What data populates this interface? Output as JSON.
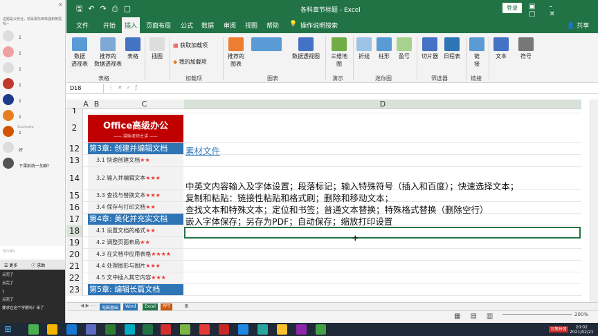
{
  "chat": {
    "top_text": "这题是公务仕，快哥那东西单选和英语吗~",
    "close": "×",
    "messages": [
      {
        "name": "",
        "text": "1",
        "color": "#ddd"
      },
      {
        "name": "",
        "text": "1",
        "color": "#f0a0a0"
      },
      {
        "name": "",
        "text": "1",
        "color": "#ddd"
      },
      {
        "name": "",
        "text": "1",
        "color": "#c0392b"
      },
      {
        "name": "",
        "text": "1",
        "color": "#1e3a8a"
      },
      {
        "name": "",
        "text": "1",
        "color": "#e67e22"
      },
      {
        "name": "Soulmate",
        "text": "1",
        "color": "#d35400"
      },
      {
        "name": "",
        "text": "好",
        "color": "#ddd"
      },
      {
        "name": "",
        "text": "下课前统一加群！",
        "color": "#555"
      }
    ],
    "input_count": "0/140",
    "bar_more": "更多",
    "bar_help": "求助",
    "bottom": [
      {
        "name": "",
        "text": "点完了"
      },
      {
        "name": "",
        "text": "点完了"
      },
      {
        "name": "",
        "text": "1"
      },
      {
        "name": "",
        "text": "点完了"
      },
      {
        "name": "",
        "text": "要求在这个学期吗？来了"
      }
    ]
  },
  "excel": {
    "title": "各科章节标题 - Excel",
    "login": "登录",
    "tabs": [
      "文件",
      "开始",
      "插入",
      "页面布局",
      "公式",
      "数据",
      "审阅",
      "视图",
      "帮助",
      "操作说明搜索"
    ],
    "selected_tab": "插入",
    "share": "共享",
    "ribbon": {
      "btn1": "数据\n透视表",
      "btn2": "推荐的\n数据透视表",
      "btn3": "表格",
      "btn4": "插图",
      "addin1": "获取加载项",
      "addin2": "我的加载项",
      "btn5": "推荐的\n图表",
      "btn6": "数据透视图",
      "btn7": "三维地\n图",
      "btn8": "折线",
      "btn9": "柱形",
      "btn10": "盈亏",
      "btn11": "切片器",
      "btn12": "日程表",
      "btn13": "链\n接",
      "btn14": "文本",
      "btn15": "符号",
      "groups": [
        "表格",
        "加载项",
        "图表",
        "演示",
        "迷你图",
        "筛选器",
        "链接"
      ]
    },
    "name_box": "D18",
    "columns": [
      "A",
      "B",
      "C",
      "D"
    ],
    "logo_title": "Office高级办公",
    "logo_sub": "—— 梁咏老师主讲 ——",
    "rows": [
      {
        "num": "1",
        "c": "",
        "d": ""
      },
      {
        "num": "2",
        "c": "",
        "d": ""
      },
      {
        "num": "12",
        "c": "第3章: 创建并编辑文档",
        "type": "ch",
        "d": "素材文件"
      },
      {
        "num": "13",
        "c": "3.1 快速创建文档",
        "stars": "★★",
        "type": "sec",
        "d": ""
      },
      {
        "num": "14",
        "c": "3.2 输入并编辑文本",
        "stars": "★★★",
        "type": "sec",
        "d": "中英文内容输入及字体设置；段落标记；输入特殊符号（插入和百度）；快速选择文本；"
      },
      {
        "num": "15",
        "c": "3.3 查找与替换文本",
        "stars": "★★★",
        "type": "sec",
        "d": "复制和粘贴：链接性粘贴和格式刷；删除和移动文本；"
      },
      {
        "num": "16",
        "c": "3.4 保存与打印文档",
        "stars": "★★",
        "type": "sec",
        "d": "查找文本和特殊文本；定位和书签；普通文本替换；特殊格式替换（删除空行）"
      },
      {
        "num": "17",
        "c": "第4章: 美化并充实文档",
        "type": "ch",
        "d": "嵌入字体保存；另存为PDF；自动保存；缩放打印设置"
      },
      {
        "num": "18",
        "c": "4.1 设置文档的格式",
        "stars": "★★",
        "type": "sec",
        "d": ""
      },
      {
        "num": "19",
        "c": "4.2 调整页面布局",
        "stars": "★★",
        "type": "sec",
        "d": ""
      },
      {
        "num": "20",
        "c": "4.3 在文档中应用表格",
        "stars": "★★★★",
        "type": "sec",
        "d": ""
      },
      {
        "num": "21",
        "c": "4.4 处理图形与图片",
        "stars": "★★★",
        "type": "sec",
        "d": ""
      },
      {
        "num": "22",
        "c": "4.5 文中插入其它内容",
        "stars": "★★★",
        "type": "sec",
        "d": ""
      },
      {
        "num": "23",
        "c": "第5章: 编辑长篇文档",
        "type": "ch",
        "d": ""
      }
    ],
    "sheets": [
      "电脑基础",
      "Word",
      "Excel",
      "PPT"
    ],
    "zoom": "200%"
  },
  "taskbar": {
    "ime": "五笔拼音",
    "time": "20:02",
    "date": "2021/02/21"
  }
}
